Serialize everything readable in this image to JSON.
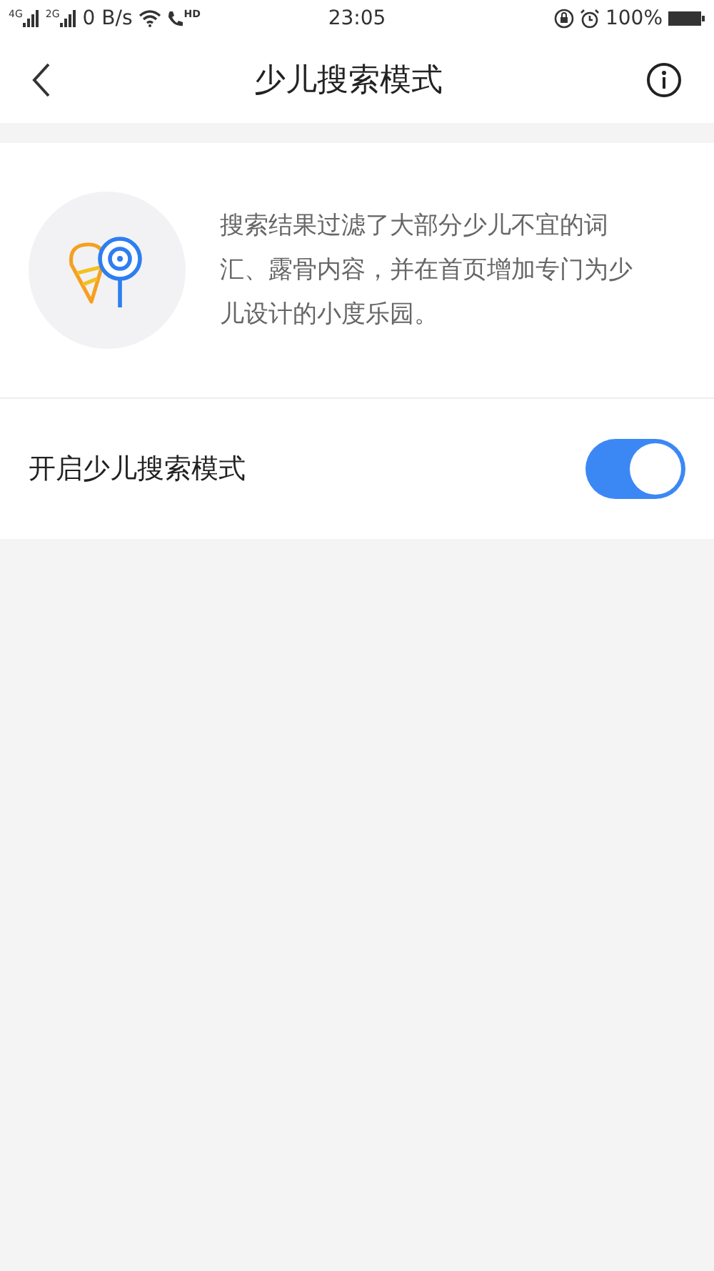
{
  "status_bar": {
    "sim1": "4G",
    "sim2": "2G",
    "speed": "0 B/s",
    "call_badge": "HD",
    "time": "23:05",
    "battery": "100%"
  },
  "header": {
    "title": "少儿搜索模式"
  },
  "intro": {
    "description": "搜索结果过滤了大部分少儿不宜的词汇、露骨内容，并在首页增加专门为少儿设计的小度乐园。"
  },
  "settings": [
    {
      "kind": "toggle",
      "label": "开启少儿搜索模式",
      "on": true
    }
  ]
}
